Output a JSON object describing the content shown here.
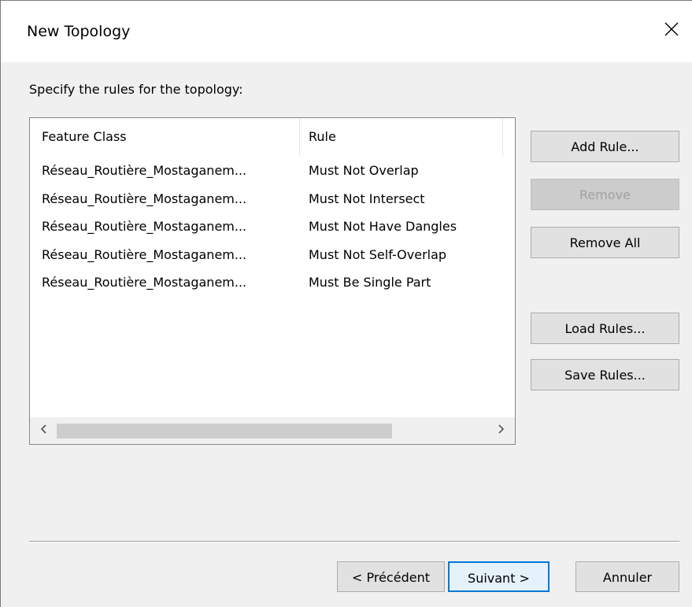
{
  "window": {
    "title": "New Topology",
    "close_icon": "close-icon"
  },
  "prompt": "Specify the rules for the topology:",
  "list": {
    "columns": [
      "Feature Class",
      "Rule"
    ],
    "rows": [
      {
        "feature_class": "Réseau_Routière_Mostaganem...",
        "rule": "Must Not Overlap"
      },
      {
        "feature_class": "Réseau_Routière_Mostaganem...",
        "rule": "Must Not Intersect"
      },
      {
        "feature_class": "Réseau_Routière_Mostaganem...",
        "rule": "Must Not Have Dangles"
      },
      {
        "feature_class": "Réseau_Routière_Mostaganem...",
        "rule": "Must Not Self-Overlap"
      },
      {
        "feature_class": "Réseau_Routière_Mostaganem...",
        "rule": "Must Be Single Part"
      }
    ],
    "scroll_left_icon": "chevron-left-icon",
    "scroll_right_icon": "chevron-right-icon"
  },
  "side_buttons": {
    "add_rule": "Add Rule...",
    "remove": "Remove",
    "remove_all": "Remove All",
    "load_rules": "Load Rules...",
    "save_rules": "Save Rules..."
  },
  "footer": {
    "back": "< Précédent",
    "next": "Suivant >",
    "cancel": "Annuler"
  },
  "colors": {
    "accent": "#0078d7",
    "button_bg": "#e1e1e1",
    "disabled_text": "#a0a0a0"
  }
}
